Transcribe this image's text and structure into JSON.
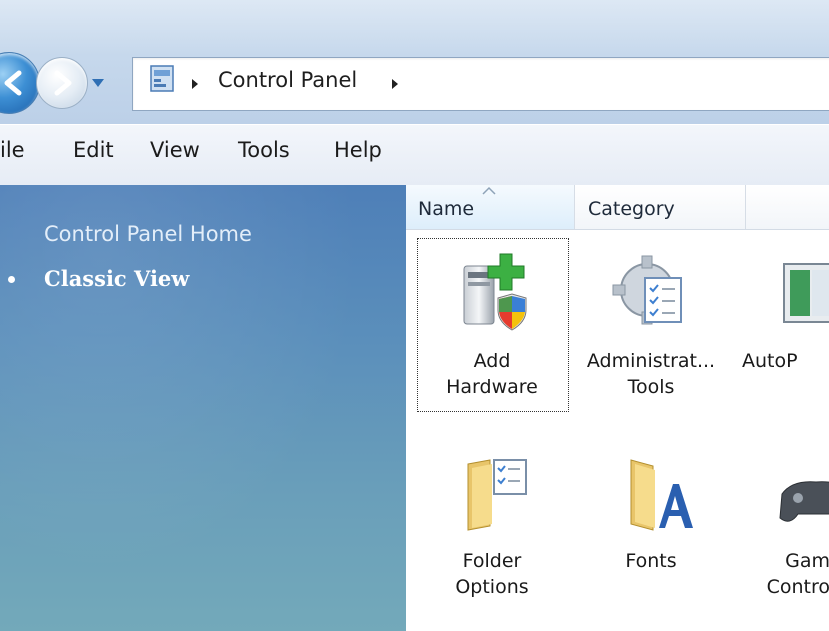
{
  "address_bar": {
    "crumb": "Control Panel"
  },
  "menu": {
    "items": [
      "ile",
      "Edit",
      "View",
      "Tools",
      "Help"
    ]
  },
  "left_pane": {
    "home_link": "Control Panel Home",
    "current_view": "Classic View"
  },
  "columns": {
    "name": "Name",
    "category": "Category"
  },
  "items": [
    {
      "line1": "Add",
      "line2": "Hardware",
      "icon": "add-hardware-icon",
      "selected": true
    },
    {
      "line1": "Administrat...",
      "line2": "Tools",
      "icon": "administrative-tools-icon"
    },
    {
      "line1": "AutoP",
      "line2": "",
      "icon": "autoplay-icon"
    },
    {
      "line1": "Folder",
      "line2": "Options",
      "icon": "folder-options-icon"
    },
    {
      "line1": "Fonts",
      "line2": "",
      "icon": "fonts-icon"
    },
    {
      "line1": "Gam",
      "line2": "Contro",
      "icon": "game-controllers-icon"
    }
  ],
  "colors": {
    "left_pane_top": "#4e7fb8",
    "left_pane_bottom": "#73a9ba",
    "address_bar_bg": "#c6d8ec",
    "column_header_active": "#ddeefb"
  }
}
